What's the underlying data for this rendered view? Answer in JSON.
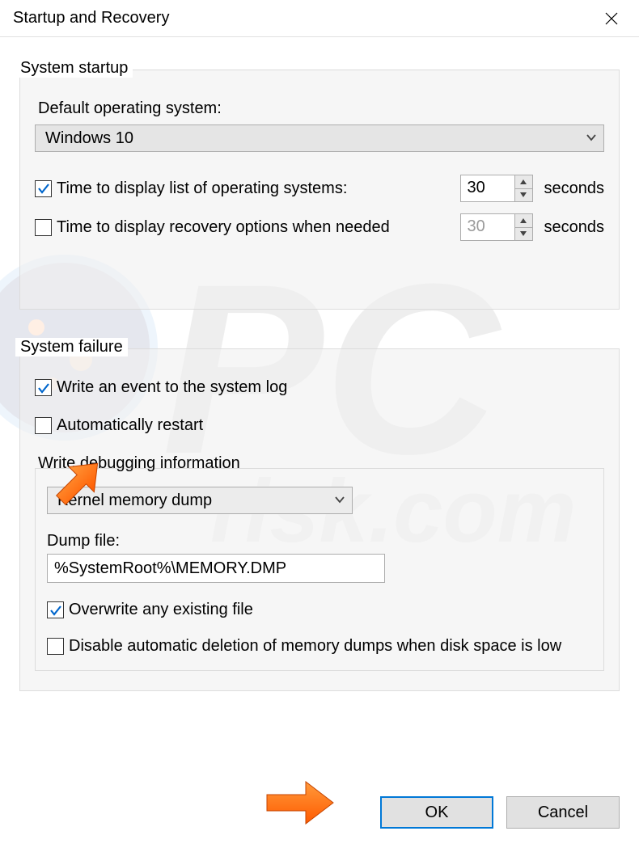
{
  "window": {
    "title": "Startup and Recovery"
  },
  "startup": {
    "legend": "System startup",
    "default_os_label": "Default operating system:",
    "default_os_value": "Windows 10",
    "time_os_label": "Time to display list of operating systems:",
    "time_os_value": "30",
    "time_recovery_label": "Time to display recovery options when needed",
    "time_recovery_value": "30",
    "seconds_label": "seconds"
  },
  "failure": {
    "legend": "System failure",
    "write_event_label": "Write an event to the system log",
    "auto_restart_label": "Automatically restart",
    "write_debug_label": "Write debugging information",
    "dump_type_value": "Kernel memory dump",
    "dump_file_label": "Dump file:",
    "dump_file_value": "%SystemRoot%\\MEMORY.DMP",
    "overwrite_label": "Overwrite any existing file",
    "disable_auto_delete_label": "Disable automatic deletion of memory dumps when disk space is low"
  },
  "buttons": {
    "ok": "OK",
    "cancel": "Cancel"
  }
}
